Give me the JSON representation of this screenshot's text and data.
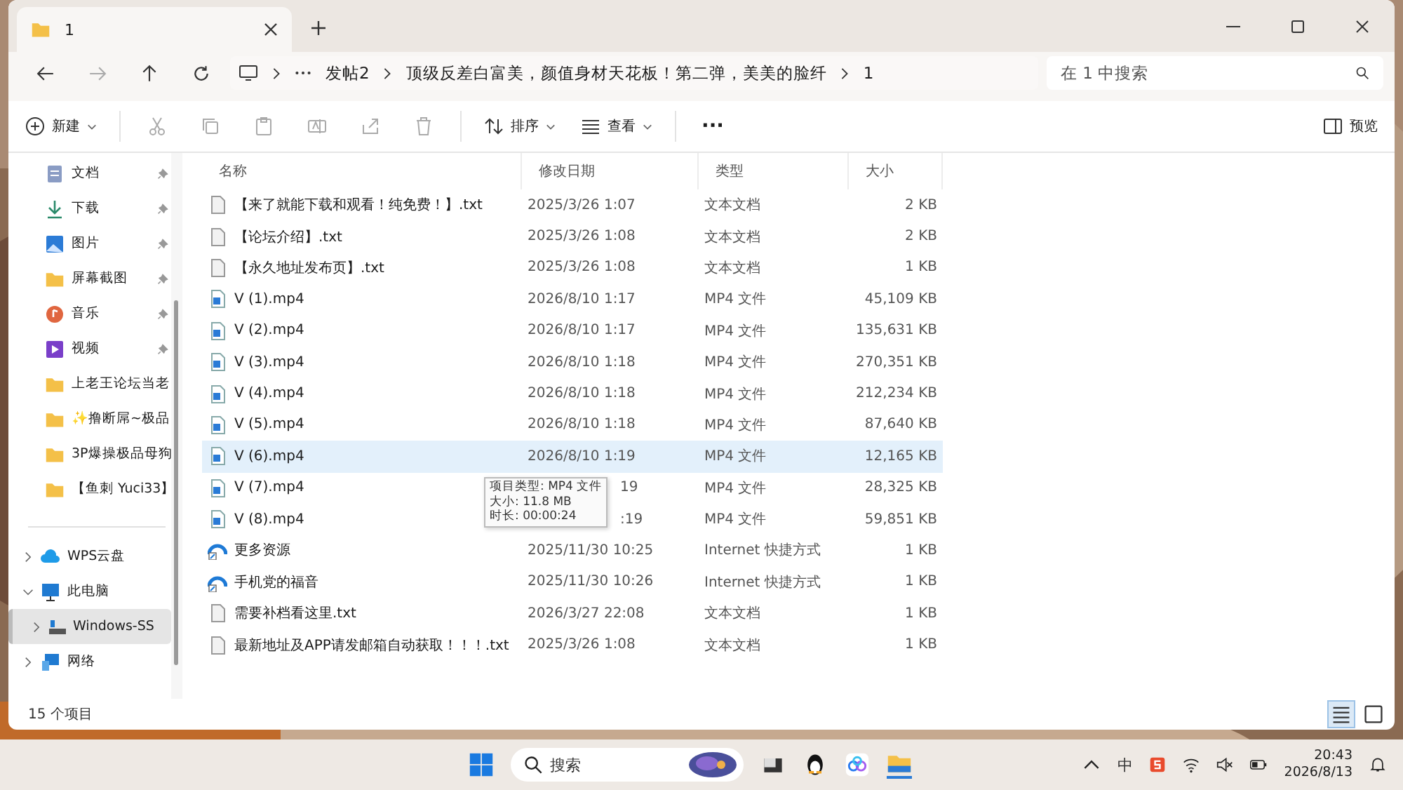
{
  "tab": {
    "title": "1"
  },
  "address": {
    "crumbs": [
      "发帖2",
      "顶级反差白富美，颜值身材天花板！第二弹，美美的脸纤",
      "1"
    ],
    "search_placeholder": "在 1 中搜索"
  },
  "toolbar": {
    "new": "新建",
    "sort": "排序",
    "view": "查看",
    "more": "···",
    "preview": "预览"
  },
  "quick_access": [
    {
      "label": "文档",
      "kind": "docs",
      "pinned": true
    },
    {
      "label": "下载",
      "kind": "download",
      "pinned": true
    },
    {
      "label": "图片",
      "kind": "pictures",
      "pinned": true
    },
    {
      "label": "屏幕截图",
      "kind": "folder",
      "pinned": true
    },
    {
      "label": "音乐",
      "kind": "music",
      "pinned": true
    },
    {
      "label": "视频",
      "kind": "video",
      "pinned": true
    },
    {
      "label": "上老王论坛当老",
      "kind": "folder",
      "pinned": false
    },
    {
      "label": "✨撸断屌~极品",
      "kind": "folder",
      "pinned": false
    },
    {
      "label": "3P爆操极品母狗",
      "kind": "folder",
      "pinned": false
    },
    {
      "label": "【鱼刺 Yuci33】",
      "kind": "folder",
      "pinned": false
    }
  ],
  "tree": [
    {
      "label": "WPS云盘",
      "kind": "cloud",
      "expanded": false,
      "selected": false
    },
    {
      "label": "此电脑",
      "kind": "pc",
      "expanded": true,
      "selected": false,
      "children": [
        {
          "label": "Windows-SS",
          "kind": "drive",
          "expanded": false,
          "selected": true
        }
      ]
    },
    {
      "label": "网络",
      "kind": "network",
      "expanded": false,
      "selected": false
    }
  ],
  "columns": [
    "名称",
    "修改日期",
    "类型",
    "大小"
  ],
  "files": [
    {
      "name": "【来了就能下载和观看！纯免费！】.txt",
      "kind": "txt",
      "date": "2025/3/26 1:07",
      "type": "文本文档",
      "size": "2 KB",
      "selected": false
    },
    {
      "name": "【论坛介绍】.txt",
      "kind": "txt",
      "date": "2025/3/26 1:08",
      "type": "文本文档",
      "size": "2 KB",
      "selected": false
    },
    {
      "name": "【永久地址发布页】.txt",
      "kind": "txt",
      "date": "2025/3/26 1:08",
      "type": "文本文档",
      "size": "1 KB",
      "selected": false
    },
    {
      "name": "V (1).mp4",
      "kind": "video",
      "date": "2026/8/10 1:17",
      "type": "MP4 文件",
      "size": "45,109 KB",
      "selected": false
    },
    {
      "name": "V (2).mp4",
      "kind": "video",
      "date": "2026/8/10 1:17",
      "type": "MP4 文件",
      "size": "135,631 KB",
      "selected": false
    },
    {
      "name": "V (3).mp4",
      "kind": "video",
      "date": "2026/8/10 1:18",
      "type": "MP4 文件",
      "size": "270,351 KB",
      "selected": false
    },
    {
      "name": "V (4).mp4",
      "kind": "video",
      "date": "2026/8/10 1:18",
      "type": "MP4 文件",
      "size": "212,234 KB",
      "selected": false
    },
    {
      "name": "V (5).mp4",
      "kind": "video",
      "date": "2026/8/10 1:18",
      "type": "MP4 文件",
      "size": "87,640 KB",
      "selected": false
    },
    {
      "name": "V (6).mp4",
      "kind": "video",
      "date": "2026/8/10 1:19",
      "type": "MP4 文件",
      "size": "12,165 KB",
      "selected": true
    },
    {
      "name": "V (7).mp4",
      "kind": "video",
      "date": "19",
      "type": "MP4 文件",
      "size": "28,325 KB",
      "selected": false,
      "covered": true
    },
    {
      "name": "V (8).mp4",
      "kind": "video",
      "date": ":19",
      "type": "MP4 文件",
      "size": "59,851 KB",
      "selected": false,
      "covered": true
    },
    {
      "name": "更多资源",
      "kind": "link",
      "date": "2025/11/30 10:25",
      "type": "Internet 快捷方式",
      "size": "1 KB",
      "selected": false
    },
    {
      "name": "手机党的福音",
      "kind": "link",
      "date": "2025/11/30 10:26",
      "type": "Internet 快捷方式",
      "size": "1 KB",
      "selected": false
    },
    {
      "name": "需要补档看这里.txt",
      "kind": "txt",
      "date": "2026/3/27 22:08",
      "type": "文本文档",
      "size": "1 KB",
      "selected": false
    },
    {
      "name": "最新地址及APP请发邮箱自动获取！！！.txt",
      "kind": "txt",
      "date": "2025/3/26 1:08",
      "type": "文本文档",
      "size": "1 KB",
      "selected": false
    }
  ],
  "tooltip": [
    "项目类型: MP4 文件",
    "大小: 11.8 MB",
    "时长: 00:00:24"
  ],
  "status": "15 个项目",
  "taskbar": {
    "search_placeholder": "搜索",
    "ime": "中",
    "time": "20:43",
    "date": "2026/8/13"
  }
}
